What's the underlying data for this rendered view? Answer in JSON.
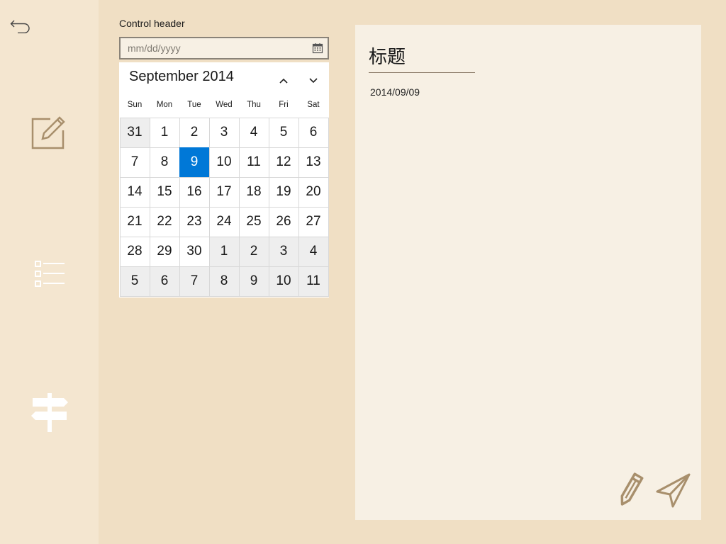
{
  "sidebar": {
    "items": [
      {
        "icon": "back-arrow-icon"
      },
      {
        "icon": "edit-note-icon"
      },
      {
        "icon": "list-icon"
      },
      {
        "icon": "signpost-icon"
      }
    ]
  },
  "date_picker": {
    "header": "Control header",
    "placeholder": "mm/dd/yyyy",
    "icon": "calendar-icon"
  },
  "calendar": {
    "month_label": "September 2014",
    "weekdays": [
      "Sun",
      "Mon",
      "Tue",
      "Wed",
      "Thu",
      "Fri",
      "Sat"
    ],
    "days": [
      {
        "n": "31",
        "out": true
      },
      {
        "n": "1"
      },
      {
        "n": "2"
      },
      {
        "n": "3"
      },
      {
        "n": "4"
      },
      {
        "n": "5"
      },
      {
        "n": "6"
      },
      {
        "n": "7"
      },
      {
        "n": "8"
      },
      {
        "n": "9",
        "selected": true
      },
      {
        "n": "10"
      },
      {
        "n": "11"
      },
      {
        "n": "12"
      },
      {
        "n": "13"
      },
      {
        "n": "14"
      },
      {
        "n": "15"
      },
      {
        "n": "16"
      },
      {
        "n": "17"
      },
      {
        "n": "18"
      },
      {
        "n": "19"
      },
      {
        "n": "20"
      },
      {
        "n": "21"
      },
      {
        "n": "22"
      },
      {
        "n": "23"
      },
      {
        "n": "24"
      },
      {
        "n": "25"
      },
      {
        "n": "26"
      },
      {
        "n": "27"
      },
      {
        "n": "28"
      },
      {
        "n": "29"
      },
      {
        "n": "30"
      },
      {
        "n": "1",
        "out": true
      },
      {
        "n": "2",
        "out": true
      },
      {
        "n": "3",
        "out": true
      },
      {
        "n": "4",
        "out": true
      },
      {
        "n": "5",
        "out": true
      },
      {
        "n": "6",
        "out": true
      },
      {
        "n": "7",
        "out": true
      },
      {
        "n": "8",
        "out": true
      },
      {
        "n": "9",
        "out": true
      },
      {
        "n": "10",
        "out": true
      },
      {
        "n": "11",
        "out": true
      }
    ],
    "selected_color": "#0078d7"
  },
  "note": {
    "title": "标题",
    "date": "2014/09/09",
    "actions": [
      "pencil-icon",
      "send-icon"
    ]
  },
  "colors": {
    "background": "#f0dfc4",
    "sidebar": "#f4e6d0",
    "panel": "#f7f0e4",
    "icon_brown": "#a88f6c"
  }
}
